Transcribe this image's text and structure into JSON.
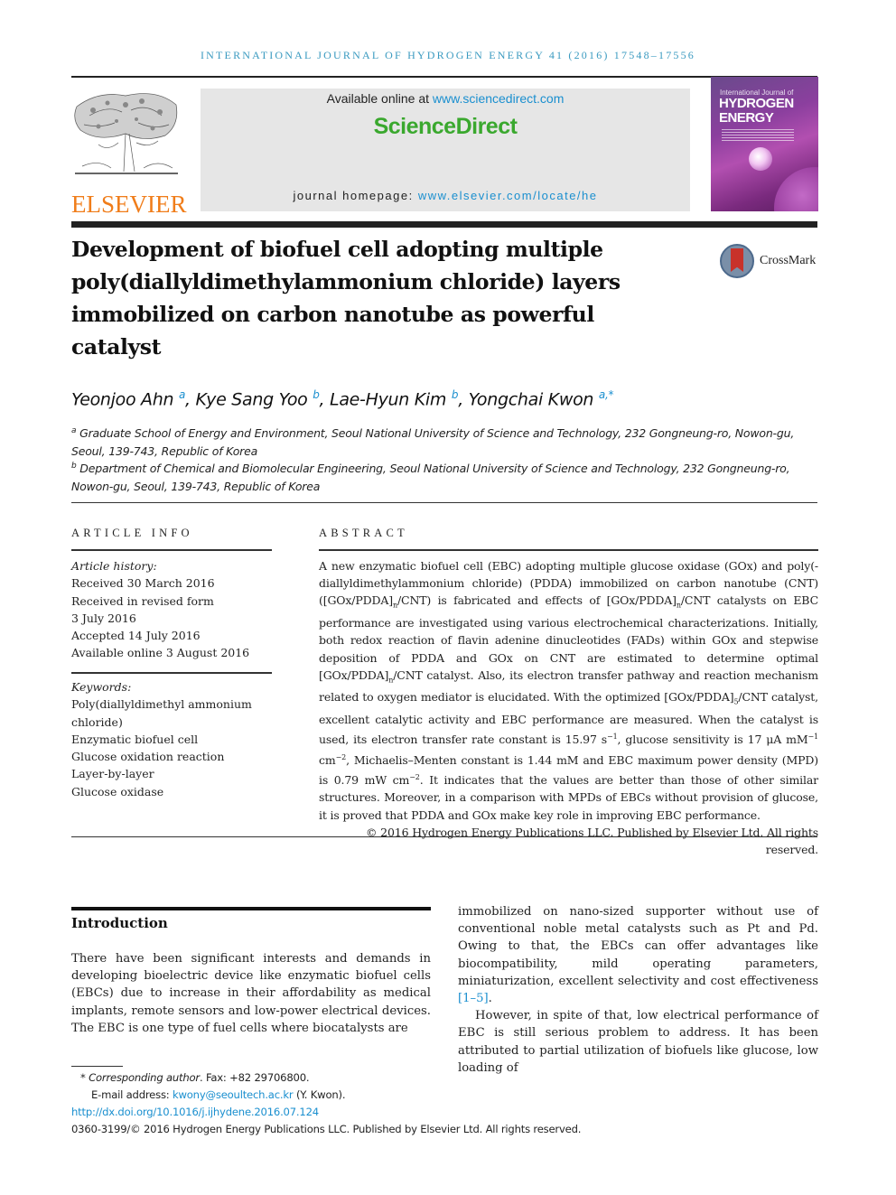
{
  "running_head": "INTERNATIONAL JOURNAL OF HYDROGEN ENERGY 41 (2016) 17548–17556",
  "publisher": {
    "logo_word": "ELSEVIER"
  },
  "sciencedirect": {
    "available_prefix": "Available online at ",
    "available_link": "www.sciencedirect.com",
    "brand": "ScienceDirect",
    "homepage_prefix": "journal homepage: ",
    "homepage_link": "www.elsevier.com/locate/he"
  },
  "cover": {
    "line1": "International Journal of",
    "line2": "HYDROGEN",
    "line3": "ENERGY"
  },
  "crossmark": {
    "label": "CrossMark"
  },
  "article": {
    "title": "Development of biofuel cell adopting multiple poly(diallyldimethylammonium chloride) layers immobilized on carbon nanotube as powerful catalyst",
    "authors": [
      {
        "name": "Yeonjoo Ahn",
        "sup": "a"
      },
      {
        "name": "Kye Sang Yoo",
        "sup": "b"
      },
      {
        "name": "Lae-Hyun Kim",
        "sup": "b"
      },
      {
        "name": "Yongchai Kwon",
        "sup": "a,*"
      }
    ],
    "affiliations": [
      {
        "mark": "a",
        "text": "Graduate School of Energy and Environment, Seoul National University of Science and Technology, 232 Gongneung-ro, Nowon-gu, Seoul, 139-743, Republic of Korea"
      },
      {
        "mark": "b",
        "text": "Department of Chemical and Biomolecular Engineering, Seoul National University of Science and Technology, 232 Gongneung-ro, Nowon-gu, Seoul, 139-743, Republic of Korea"
      }
    ]
  },
  "article_info": {
    "heading": "ARTICLE INFO",
    "history_label": "Article history:",
    "history": [
      "Received 30 March 2016",
      "Received in revised form",
      "3 July 2016",
      "Accepted 14 July 2016",
      "Available online 3 August 2016"
    ],
    "keywords_label": "Keywords:",
    "keywords": [
      "Poly(diallyldimethyl ammonium",
      "chloride)",
      "Enzymatic biofuel cell",
      "Glucose oxidation reaction",
      "Layer-by-layer",
      "Glucose oxidase"
    ]
  },
  "abstract": {
    "heading": "ABSTRACT",
    "p1": "A new enzymatic biofuel cell (EBC) adopting multiple glucose oxidase (GOx) and poly(-diallyldimethylammonium chloride) (PDDA) immobilized on carbon nanotube (CNT) ([GOx/PDDA]",
    "sub_n": "n",
    "p2": "/CNT) is fabricated and effects of [GOx/PDDA]",
    "p3": "/CNT catalysts on EBC performance are investigated using various electrochemical characterizations. Initially, both redox reaction of flavin adenine dinucleotides (FADs) within GOx and stepwise deposition of PDDA and GOx on CNT are estimated to determine optimal [GOx/PDDA]",
    "p4": "/CNT catalyst. Also, its electron transfer pathway and reaction mechanism related to oxygen mediator is elucidated. With the optimized [GOx/PDDA]",
    "sub_5": "5",
    "p5": "/CNT catalyst, excellent catalytic activity and EBC performance are measured. When the catalyst is used, its electron transfer rate constant is 15.97 s",
    "sup_m1": "−1",
    "p6": ", glucose sensitivity is 17 μA mM",
    "p7": " cm",
    "sup_m2": "−2",
    "p8": ", Michaelis–Menten constant is 1.44 mM and EBC maximum power density (MPD) is 0.79 mW cm",
    "p9": ". It indicates that the values are better than those of other similar structures. Moreover, in a comparison with MPDs of EBCs without provision of glucose, it is proved that PDDA and GOx make key role in improving EBC performance.",
    "copyright": "© 2016 Hydrogen Energy Publications LLC. Published by Elsevier Ltd. All rights reserved."
  },
  "introduction": {
    "heading": "Introduction",
    "left_col": "There have been significant interests and demands in developing bioelectric device like enzymatic biofuel cells (EBCs) due to increase in their affordability as medical implants, remote sensors and low-power electrical devices. The EBC is one type of fuel cells where biocatalysts are",
    "right_p1": "immobilized on nano-sized supporter without use of conventional noble metal catalysts such as Pt and Pd. Owing to that, the EBCs can offer advantages like biocompatibility, mild operating parameters, miniaturization, excellent selectivity and cost effectiveness ",
    "right_ref": "[1–5]",
    "right_p1_end": ".",
    "right_p2": "However, in spite of that, low electrical performance of EBC is still serious problem to address. It has been attributed to partial utilization of biofuels like glucose, low loading of"
  },
  "footnotes": {
    "corr_mark": "*",
    "corr_label": "Corresponding author",
    "corr_rest": ". Fax: +82 29706800.",
    "email_label": "E-mail address: ",
    "email": "kwony@seoultech.ac.kr",
    "email_rest": " (Y. Kwon).",
    "doi": "http://dx.doi.org/10.1016/j.ijhydene.2016.07.124",
    "issn": "0360-3199/© 2016 Hydrogen Energy Publications LLC. Published by Elsevier Ltd. All rights reserved."
  }
}
